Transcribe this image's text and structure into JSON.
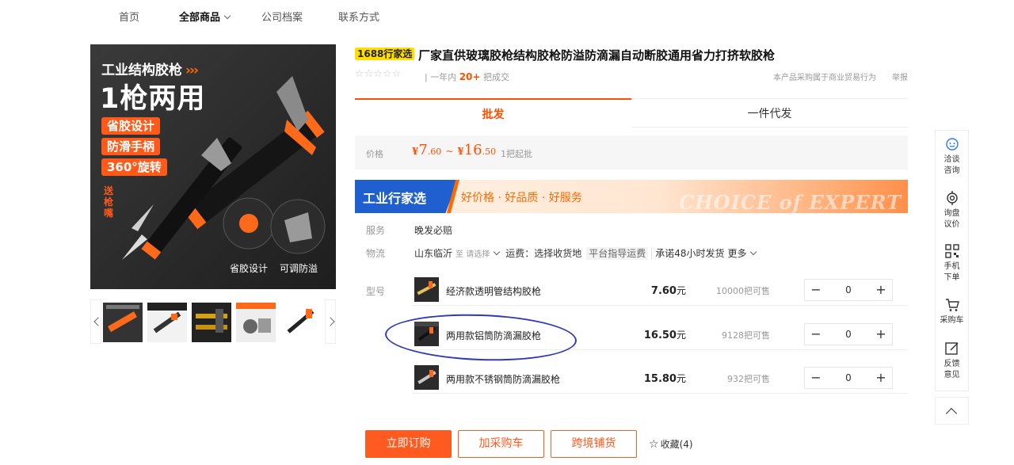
{
  "nav": {
    "items": [
      {
        "label": "首页"
      },
      {
        "label": "全部商品"
      },
      {
        "label": "公司档案"
      },
      {
        "label": "联系方式"
      }
    ]
  },
  "gallery": {
    "hero_title": "工业结构胶枪",
    "hero_arrows": "›››",
    "hero_big": "1枪两用",
    "tags": [
      "省胶设计",
      "防滑手柄",
      "360°旋转"
    ],
    "gift": "送枪嘴",
    "captions": [
      "省胶设计",
      "可调防溢"
    ]
  },
  "product": {
    "badge": "1688行家选",
    "title": "厂家直供玻璃胶枪结构胶枪防溢防滴漏自动断胶通用省力打挤软胶枪",
    "stars": "☆☆☆☆☆",
    "sales_prefix": "一年内",
    "sales_num": "20+",
    "sales_suffix": "把成交",
    "legal": "本产品采购属于商业贸易行为",
    "report": "举报"
  },
  "tabs": {
    "wholesale": "批发",
    "dropship": "一件代发"
  },
  "price": {
    "label": "价格",
    "currency": "¥",
    "low_int": "7",
    "low_dec": ".60",
    "tilde": "~",
    "high_int": "16",
    "high_dec": ".50",
    "min_order": "1把起批"
  },
  "banner": {
    "title": "工业行家选",
    "slogan": "好价格 · 好品质 · 好服务",
    "watermark": "CHOICE of EXPERT"
  },
  "service": {
    "label": "服务",
    "value": "晚发必赔"
  },
  "logistics": {
    "label": "物流",
    "origin": "山东临沂",
    "select": "至 请选择",
    "fee": "运费：选择收货地",
    "fee_tag": "平台指导运费",
    "promise": "承诺48小时发货",
    "more": "更多"
  },
  "sku": {
    "label": "型号",
    "unit_price": "元",
    "items": [
      {
        "name": "经济款透明管结构胶枪",
        "price": "7.60",
        "stock": "10000把可售",
        "qty": "0"
      },
      {
        "name": "两用款铝筒防滴漏胶枪",
        "price": "16.50",
        "stock": "9128把可售",
        "qty": "0"
      },
      {
        "name": "两用款不锈钢筒防滴漏胶枪",
        "price": "15.80",
        "stock": "932把可售",
        "qty": "0"
      }
    ]
  },
  "stepper": {
    "minus": "−",
    "plus": "+"
  },
  "actions": {
    "buy": "立即订购",
    "cart": "加采购车",
    "cross": "跨境铺货",
    "fav_icon": "☆",
    "fav": "收藏(4)"
  },
  "sidebar": {
    "items": [
      {
        "label": "洽谈咨询",
        "icon": "chat-icon"
      },
      {
        "label": "询盘议价",
        "icon": "target-icon"
      },
      {
        "label": "手机下单",
        "icon": "qrcode-icon"
      },
      {
        "label": "采购车",
        "icon": "cart-icon"
      },
      {
        "label": "反馈意见",
        "icon": "feedback-icon"
      }
    ]
  },
  "colors": {
    "accent": "#ff5000",
    "badge": "#ffde00",
    "banner_blue": "#1f5fcf",
    "annotation": "#2f3bb5"
  }
}
